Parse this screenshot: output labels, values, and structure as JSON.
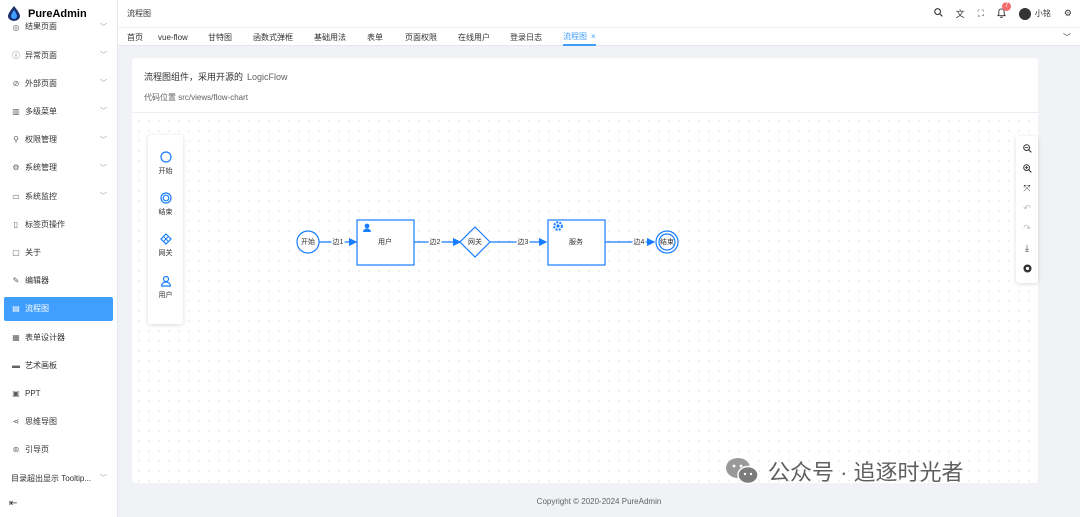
{
  "app": {
    "title": "PureAdmin"
  },
  "sidebar": {
    "partial_item": "结果页面",
    "items": [
      {
        "label": "异常页面",
        "icon": "ⓘ",
        "chevron": true
      },
      {
        "label": "外部页面",
        "icon": "⊘",
        "chevron": true
      },
      {
        "label": "多级菜单",
        "icon": "▥",
        "chevron": true
      },
      {
        "label": "权限管理",
        "icon": "⚲",
        "chevron": true
      },
      {
        "label": "系统管理",
        "icon": "⚙",
        "chevron": true
      },
      {
        "label": "系统监控",
        "icon": "▭",
        "chevron": true
      },
      {
        "label": "标签页操作",
        "icon": "▯",
        "chevron": false
      },
      {
        "label": "关于",
        "icon": "▢",
        "chevron": false
      },
      {
        "label": "编辑器",
        "icon": "✎",
        "chevron": false
      },
      {
        "label": "流程图",
        "icon": "▤",
        "chevron": false,
        "active": true
      },
      {
        "label": "表单设计器",
        "icon": "▦",
        "chevron": false
      },
      {
        "label": "艺术画板",
        "icon": "▬",
        "chevron": false
      },
      {
        "label": "PPT",
        "icon": "▣",
        "chevron": false
      },
      {
        "label": "思维导图",
        "icon": "⋖",
        "chevron": false
      },
      {
        "label": "引导页",
        "icon": "⊛",
        "chevron": false
      },
      {
        "label": "目录超出显示 Tooltip...",
        "icon": "",
        "chevron": true
      }
    ],
    "collapse_icon": "⇤"
  },
  "header": {
    "breadcrumb": "流程图",
    "notification_count": "7",
    "username": "小铭"
  },
  "tabs": {
    "items": [
      "首页",
      "vue-flow",
      "甘特图",
      "函数式弹框",
      "基础用法",
      "表单",
      "页面权限",
      "在线用户",
      "登录日志",
      "流程图"
    ],
    "active_index": 9
  },
  "card": {
    "title": "流程图组件，采用开源的",
    "title_link": "LogicFlow",
    "path": "代码位置 src/views/flow-chart"
  },
  "palette": {
    "items": [
      "开始",
      "结束",
      "网关",
      "用户"
    ]
  },
  "flow": {
    "nodes": {
      "start": "开始",
      "user": "用户",
      "gateway": "网关",
      "service": "服务",
      "end": "结束"
    },
    "edges": [
      "边1",
      "边2",
      "边3",
      "边4"
    ]
  },
  "footer": {
    "copyright": "Copyright © 2020-2024 PureAdmin"
  },
  "watermark": {
    "text": "公众号 · 追逐时光者"
  },
  "colors": {
    "primary": "#409eff",
    "flow_stroke": "#187dff"
  }
}
